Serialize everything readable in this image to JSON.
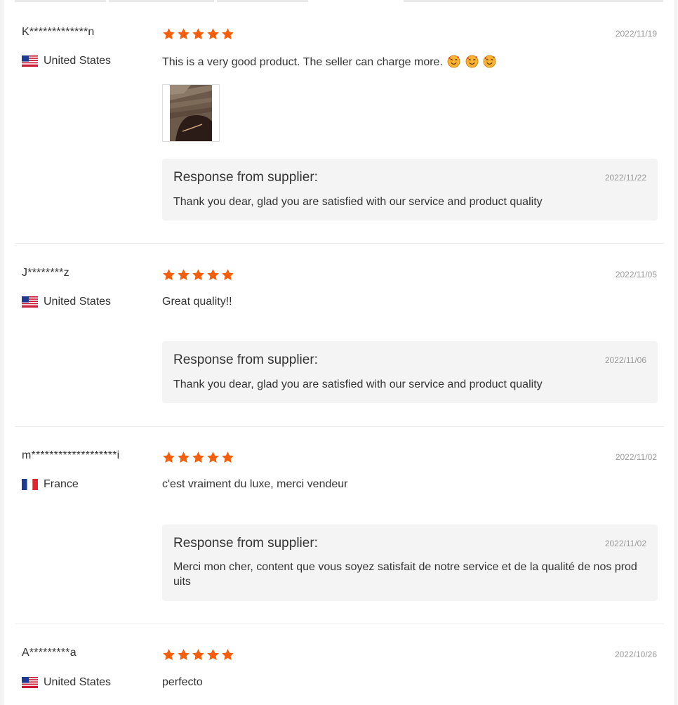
{
  "colors": {
    "star": "#f55e0a",
    "date": "#999999",
    "response_bg": "#f4f4f4"
  },
  "response_label": "Response from supplier:",
  "reviews": [
    {
      "name": "K*************n",
      "country": "United States",
      "flag": "us-flag",
      "rating": 5,
      "date": "2022/11/19",
      "text": "This is a very good product. The seller can charge more.",
      "emojis": [
        "smiling-face-with-hearts-emoji",
        "smiling-face-with-hearts-emoji",
        "smiling-face-with-hearts-emoji"
      ],
      "has_photo": true,
      "response": {
        "date": "2022/11/22",
        "text": "Thank you dear, glad you are satisfied with our service and product quality"
      }
    },
    {
      "name": "J********z",
      "country": "United States",
      "flag": "us-flag",
      "rating": 5,
      "date": "2022/11/05",
      "text": "Great quality!!",
      "response": {
        "date": "2022/11/06",
        "text": "Thank you dear, glad you are satisfied with our service and product quality"
      }
    },
    {
      "name": "m*******************i",
      "country": "France",
      "flag": "france-flag",
      "rating": 5,
      "date": "2022/11/02",
      "text": "c'est vraiment du luxe, merci vendeur",
      "response": {
        "date": "2022/11/02",
        "text": "Merci mon cher, content que vous soyez satisfait de notre service et de la qualité de nos prod uits"
      }
    },
    {
      "name": "A*********a",
      "country": "United States",
      "flag": "us-flag",
      "rating": 5,
      "date": "2022/10/26",
      "text": "perfecto"
    }
  ]
}
